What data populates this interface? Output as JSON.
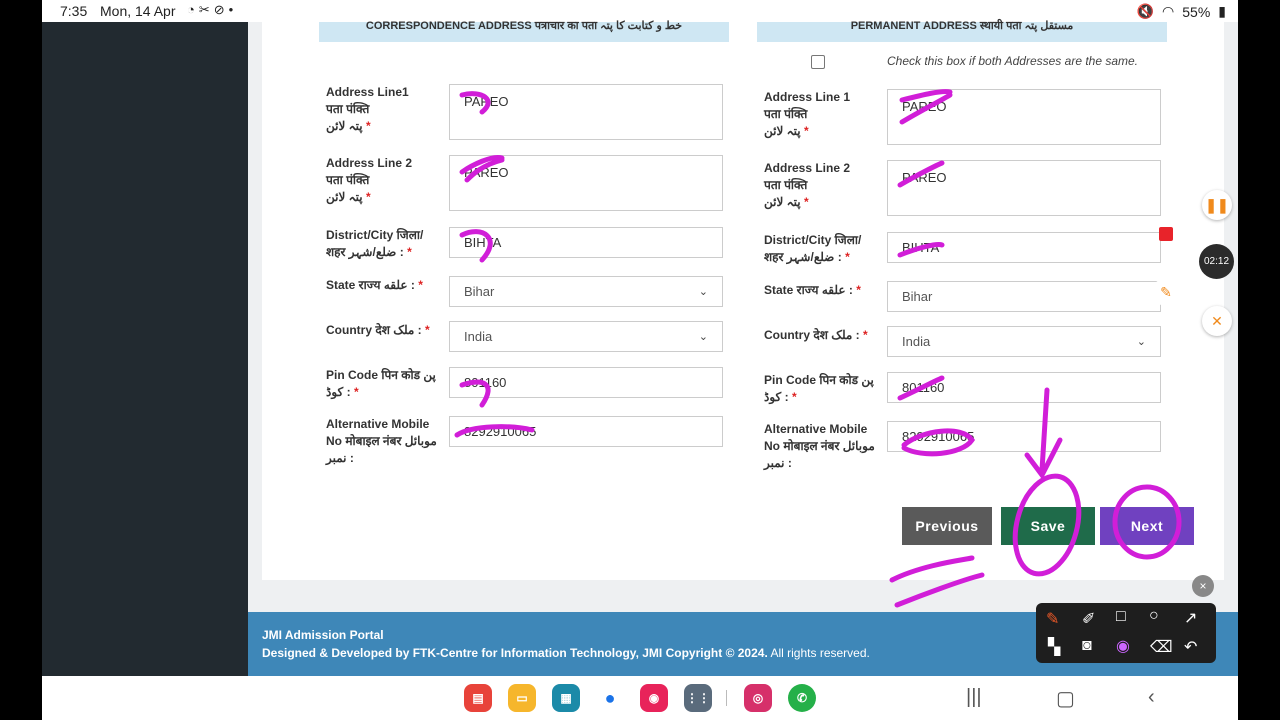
{
  "status_bar": {
    "time": "7:35",
    "date": "Mon, 14 Apr",
    "battery": "55%"
  },
  "correspondence": {
    "heading": "CORRESPONDENCE ADDRESS पत्राचार का पता خط و کتابت کا پتہ",
    "address_line1": {
      "label_en": "Address Line1",
      "label_hi": "पता पंक्ति",
      "label_ur": "پتہ لائن",
      "value": "PAREO"
    },
    "address_line2": {
      "label_en": "Address Line 2",
      "label_hi": "पता पंक्ति",
      "label_ur": "پتہ لائن",
      "value": "PAREO"
    },
    "district": {
      "label_en": "District/City जिला/",
      "label_hi": "शहर ضلع/شہر :",
      "value": "BIHTA"
    },
    "state": {
      "label": "State राज्य علقه :",
      "value": "Bihar"
    },
    "country": {
      "label": "Country देश ملک :",
      "value": "India"
    },
    "pincode": {
      "label_en": "Pin Code पिन कोड پن",
      "label_ur": "کوڈ :",
      "value": "801160"
    },
    "alt_mobile": {
      "label_en": "Alternative Mobile",
      "label_hi": "No मोबाइल नंबर موبائل",
      "label_ur": "نمبر :",
      "value": "8292910065"
    }
  },
  "permanent": {
    "heading": "PERMANENT ADDRESS स्थायी पता مستقل پتہ",
    "same_checkbox_text": "Check this box if both Addresses are the same.",
    "address_line1": {
      "label_en": "Address Line 1",
      "label_hi": "पता पंक्ति",
      "label_ur": "پتہ لائن",
      "value": "PAREO"
    },
    "address_line2": {
      "label_en": "Address Line 2",
      "label_hi": "पता पंक्ति",
      "label_ur": "پتہ لائن",
      "value": "PAREO"
    },
    "district": {
      "label_en": "District/City जिला/",
      "label_hi": "शहर ضلع/شہر :",
      "value": "BIHTA"
    },
    "state": {
      "label": "State राज्य علقه :",
      "value": "Bihar"
    },
    "country": {
      "label": "Country देश ملک :",
      "value": "India"
    },
    "pincode": {
      "label_en": "Pin Code पिन कोड پن",
      "label_ur": "کوڈ :",
      "value": "801160"
    },
    "alt_mobile": {
      "label_en": "Alternative Mobile",
      "label_hi": "No मोबाइल नंबर موبائل",
      "label_ur": "نمبر :",
      "value": "8292910065"
    }
  },
  "buttons": {
    "previous": "Previous",
    "save": "Save",
    "next": "Next"
  },
  "footer": {
    "portal": "JMI Admission Portal",
    "credit": "Designed & Developed by FTK-Centre for Information Technology, JMI Copyright © 2024.",
    "rights": "All rights reserved."
  },
  "recorder": {
    "timer": "02:12"
  },
  "colors": {
    "sidebar": "#222a30",
    "section_head": "#cfe7f3",
    "footer": "#3e87b8",
    "previous_btn": "#5a5a5a",
    "save_btn": "#1f6b4a",
    "next_btn": "#7041c0",
    "ink": "#d11ed8"
  }
}
